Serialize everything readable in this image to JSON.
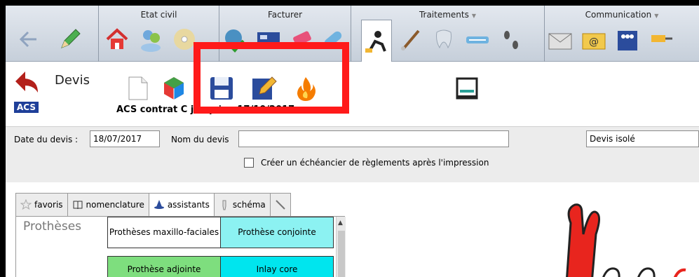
{
  "ribbon": {
    "groups": [
      {
        "title": "Etat civil"
      },
      {
        "title": "Facturer"
      },
      {
        "title": "Traitements"
      },
      {
        "title": "Communication"
      }
    ]
  },
  "toolbar": {
    "title": "Devis",
    "acs_badge": "ACS",
    "contract_text": "ACS contrat C jusqu'au 17/10/2017"
  },
  "form": {
    "date_label": "Date du devis :",
    "date_value": "18/07/2017",
    "name_label": "Nom du devis",
    "name_value": "",
    "type_value": "Devis isolé",
    "schedule_label": "Créer un échéancier de règlements après l'impression"
  },
  "tabs": [
    {
      "label": "favoris"
    },
    {
      "label": "nomenclature"
    },
    {
      "label": "assistants"
    },
    {
      "label": "schéma"
    }
  ],
  "panel": {
    "category": "Prothèses",
    "cells": [
      {
        "label": "Prothèses maxillo-faciales",
        "color": "#ffffff"
      },
      {
        "label": "Prothèse conjointe",
        "color": "#8cf2f2"
      },
      {
        "label": "Prothèse adjointe",
        "color": "#7ede7e"
      },
      {
        "label": "Inlay core",
        "color": "#00e5ee"
      }
    ]
  },
  "colors": {
    "highlight": "#ff1a1a",
    "acs_badge": "#1f3f99"
  }
}
